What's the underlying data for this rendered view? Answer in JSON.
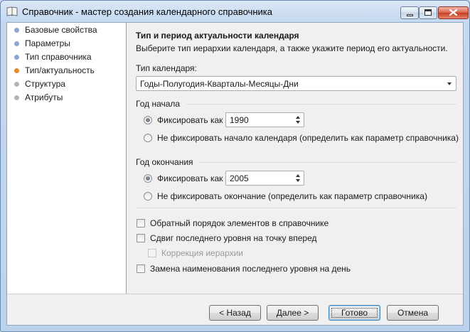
{
  "window": {
    "title": "Справочник - мастер создания календарного справочника"
  },
  "nav": {
    "items": [
      {
        "label": "Базовые свойства",
        "state": "done"
      },
      {
        "label": "Параметры",
        "state": "done"
      },
      {
        "label": "Тип справочника",
        "state": "done"
      },
      {
        "label": "Тип/актуальность",
        "state": "current"
      },
      {
        "label": "Структура",
        "state": "pending"
      },
      {
        "label": "Атрибуты",
        "state": "pending"
      }
    ]
  },
  "page": {
    "heading": "Тип и период актуальности календаря",
    "subheading": "Выберите тип иерархии календаря, а также укажите период его актуальности.",
    "calendar_type_label": "Тип календаря:",
    "calendar_type_value": "Годы-Полугодия-Кварталы-Месяцы-Дни",
    "start": {
      "group": "Год начала",
      "fix_label": "Фиксировать как",
      "fix_value": "1990",
      "nofix_label": "Не фиксировать начало календаря (определить как параметр справочника)"
    },
    "end": {
      "group": "Год окончания",
      "fix_label": "Фиксировать как",
      "fix_value": "2005",
      "nofix_label": "Не фиксировать окончание (определить как параметр справочника)"
    },
    "options": {
      "reverse_order": "Обратный порядок элементов в справочнике",
      "shift_last_level": "Сдвиг последнего уровня на точку вперед",
      "hierarchy_correction": "Коррекция иерархии",
      "rename_last_level": "Замена наименования последнего уровня на день"
    }
  },
  "footer": {
    "back": "< Назад",
    "next": "Далее >",
    "finish": "Готово",
    "cancel": "Отмена"
  },
  "colors": {
    "done_dot": "#8ca6d4",
    "current_dot": "#e98a28",
    "pending_dot": "#b4b4b4",
    "close_button": "#c33c20"
  }
}
